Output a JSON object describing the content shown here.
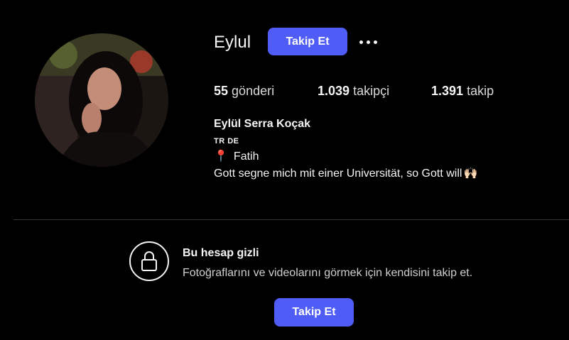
{
  "profile": {
    "username": "Eylul",
    "follow_label": "Takip Et",
    "more_icon": "more-horizontal-icon",
    "stats": {
      "posts_count": "55",
      "posts_label": "gönderi",
      "followers_count": "1.039",
      "followers_label": "takipçi",
      "following_count": "1.391",
      "following_label": "takip"
    },
    "full_name": "Eylül Serra Koçak",
    "flags": "TR DE",
    "location_icon": "📍",
    "location": "Fatih",
    "bio": "Gott segne mich mit einer Universität, so Gott will",
    "bio_emoji": "🙌🏻"
  },
  "private_notice": {
    "icon": "lock-icon",
    "title": "Bu hesap gizli",
    "description": "Fotoğraflarını ve videolarını görmek için kendisini takip et.",
    "follow_label": "Takip Et"
  },
  "colors": {
    "background": "#000000",
    "accent": "#4f5cf5",
    "text": "#f5f5f5",
    "divider": "#363636"
  }
}
